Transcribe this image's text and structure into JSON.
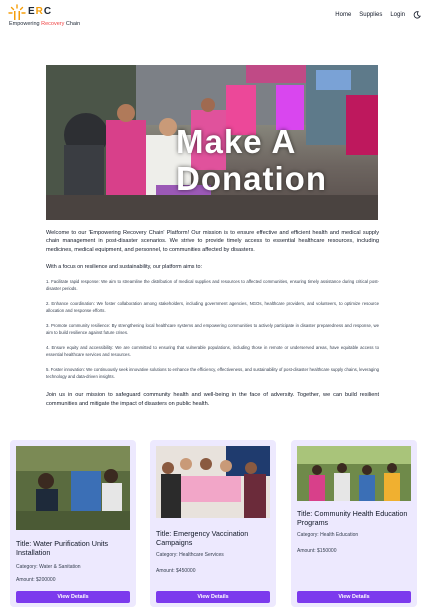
{
  "header": {
    "logo": {
      "letters_e": "E",
      "letters_r": "R",
      "letters_c": "C",
      "tagline_1": "Empowering ",
      "tagline_2": "Recovery",
      "tagline_3": " Chain"
    },
    "nav": [
      {
        "label": "Home"
      },
      {
        "label": "Supplies"
      },
      {
        "label": "Login"
      }
    ],
    "theme_icon": "moon-icon"
  },
  "hero": {
    "title_line1": "Make A",
    "title_line2": "Donation"
  },
  "content": {
    "intro": "Welcome to our 'Empowering Recovery Chain' Platform! Our mission is to ensure effective and efficient health and medical supply chain management in post-disaster scenarios. We strive to provide timely access to essential healthcare resources, including medicines, medical equipment, and personnel, to communities affected by disasters.",
    "focus": "With a focus on resilience and sustainability, our platform aims to:",
    "items": [
      "1. Facilitate rapid response: We aim to streamline the distribution of medical supplies and resources to affected communities, ensuring timely assistance during critical post-disaster periods.",
      "2. Enhance coordination: We foster collaboration among stakeholders, including government agencies, NGOs, healthcare providers, and volunteers, to optimize resource allocation and response efforts.",
      "3. Promote community resilience: By strengthening local healthcare systems and empowering communities to actively participate in disaster preparedness and response, we aim to build resilience against future crises.",
      "4. Ensure equity and accessibility: We are committed to ensuring that vulnerable populations, including those in remote or underserved areas, have equitable access to essential healthcare services and resources.",
      "5. Foster innovation: We continuously seek innovative solutions to enhance the efficiency, effectiveness, and sustainability of post-disaster healthcare supply chains, leveraging technology and data-driven insights."
    ],
    "join": "Join us in our mission to safeguard community health and well-being in the face of adversity. Together, we can build resilient communities and mitigate the impact of disasters on public health."
  },
  "cards": [
    {
      "title": "Title: Water Purification Units Installation",
      "category": "Category: Water & Sanitation",
      "amount": "Amount: $200000",
      "button": "View Details"
    },
    {
      "title": "Title: Emergency Vaccination Campaigns",
      "category": "Category: Healthcare Services",
      "amount": "Amount: $450000",
      "button": "View Details"
    },
    {
      "title": "Title: Community Health Education Programs",
      "category": "Category: Health Education",
      "amount": "Amount: $150000",
      "button": "View Details"
    }
  ],
  "colors": {
    "accent": "#7c3aed",
    "card_bg": "#ede9fe",
    "logo_orange": "#f59e0b"
  }
}
